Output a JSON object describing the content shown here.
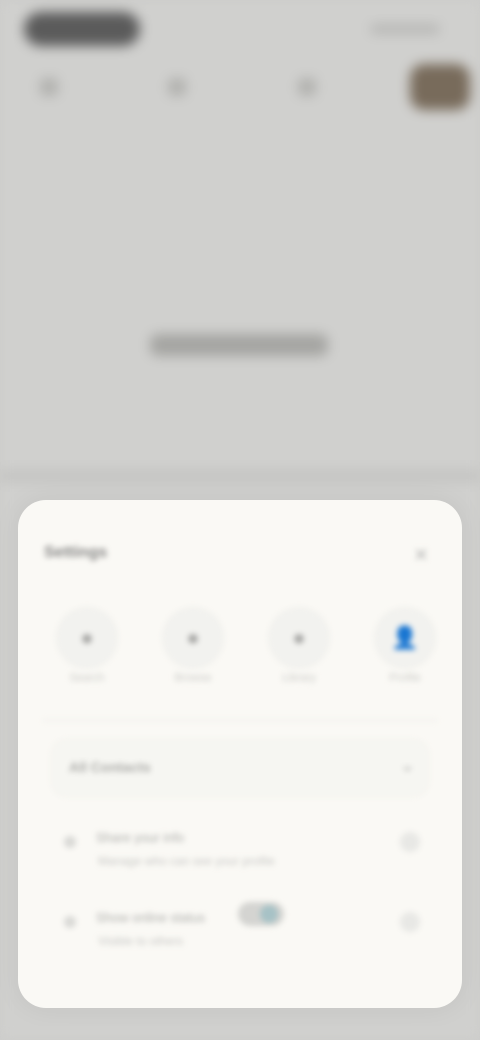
{
  "sheet": {
    "title": "Settings",
    "close_icon": "close-icon",
    "shortcuts": [
      {
        "icon": "circle-icon",
        "label": "Search"
      },
      {
        "icon": "circle-icon",
        "label": "Browse"
      },
      {
        "icon": "circle-icon",
        "label": "Library"
      },
      {
        "icon": "person-icon",
        "label": "Profile"
      }
    ],
    "select": {
      "value": "All Contacts",
      "chevron_icon": "chevron-down-icon"
    },
    "options": [
      {
        "title": "Share your info",
        "subtitle": "Manage who can see your profile"
      },
      {
        "title": "Show online status",
        "subtitle": "Visible to others"
      }
    ]
  },
  "background": {
    "center_text": "Live Activity"
  },
  "colors": {
    "background": "#d0d0ce",
    "sheet": "#faf9f5",
    "accent": "#a7c2c6"
  }
}
